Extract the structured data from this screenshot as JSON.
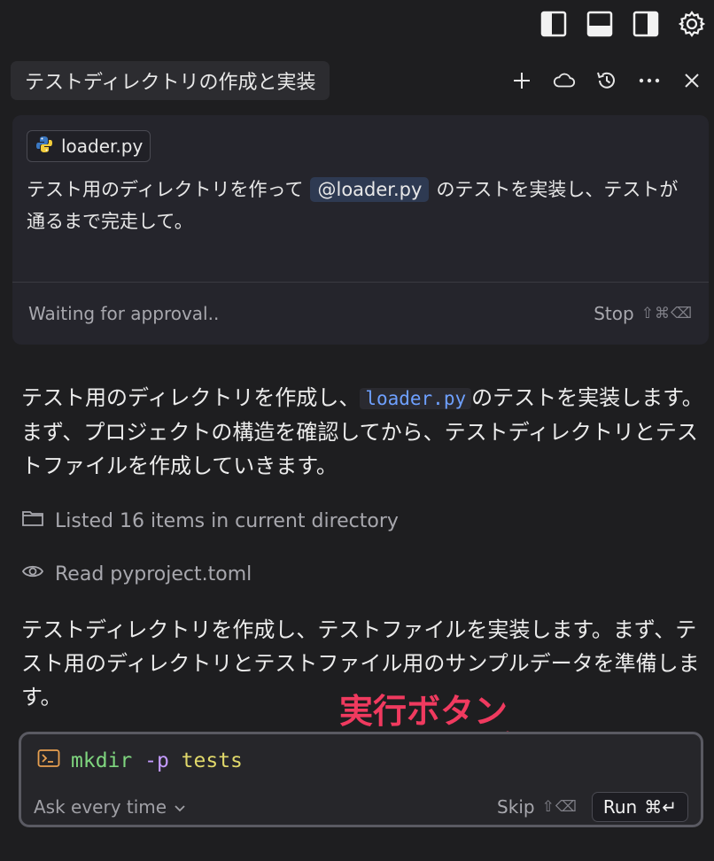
{
  "toolbar": {
    "icons": [
      "toggle-left-panel-icon",
      "toggle-bottom-panel-icon",
      "toggle-right-panel-icon",
      "settings-gear-icon"
    ]
  },
  "chat": {
    "title": "テストディレクトリの作成と実装",
    "actions": [
      "new-chat-icon",
      "cloud-icon",
      "history-icon",
      "more-icon",
      "close-icon"
    ]
  },
  "request": {
    "file_chip": "loader.py",
    "text_before": "テスト用のディレクトリを作って",
    "mention": "@loader.py",
    "text_after": "のテストを実装し、テストが通るまで完走して。",
    "status": "Waiting for approval..",
    "stop_label": "Stop",
    "stop_shortcut": "⇧⌘⌫"
  },
  "assistant": {
    "para1_before": "テスト用のディレクトリを作成し、",
    "para1_code": "loader.py",
    "para1_after": "のテストを実装します。まず、プロジェクトの構造を確認してから、テストディレクトリとテストファイルを作成していきます。",
    "tool1": "Listed 16 items in current directory",
    "tool2": "Read pyproject.toml",
    "para2": "テストディレクトリを作成し、テストファイルを実装します。まず、テスト用のディレクトリとテストファイル用のサンプルデータを準備します。"
  },
  "annotation": {
    "label": "実行ボタン",
    "color": "#f03a5f"
  },
  "terminal": {
    "cmd": "mkdir",
    "flag": "-p",
    "arg": "tests",
    "ask_mode": "Ask every time",
    "skip_label": "Skip",
    "skip_shortcut": "⇧⌫",
    "run_label": "Run",
    "run_shortcut": "⌘↵"
  }
}
